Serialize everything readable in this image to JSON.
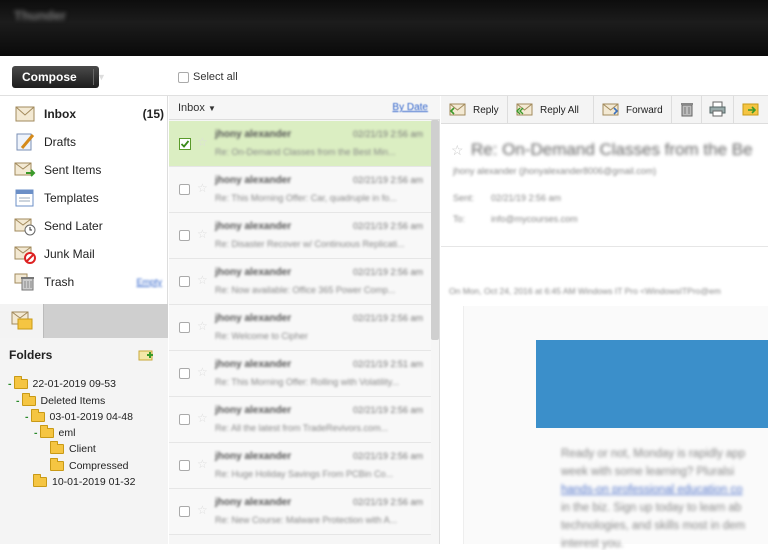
{
  "app": {
    "title_blurred": "Thunder"
  },
  "toolbar": {
    "compose_label": "Compose",
    "select_all_label": "Select all"
  },
  "nav": [
    {
      "label": "Inbox",
      "count": "(15)",
      "icon": "inbox-icon"
    },
    {
      "label": "Drafts",
      "icon": "drafts-icon"
    },
    {
      "label": "Sent Items",
      "icon": "sent-icon"
    },
    {
      "label": "Templates",
      "icon": "templates-icon"
    },
    {
      "label": "Send Later",
      "icon": "send-later-icon"
    },
    {
      "label": "Junk Mail",
      "icon": "junk-icon"
    },
    {
      "label": "Trash",
      "icon": "trash-icon",
      "action": "Empty"
    }
  ],
  "folders": {
    "title": "Folders",
    "tree": [
      {
        "label": "22-01-2019 09-53"
      },
      {
        "label": "Deleted Items"
      },
      {
        "label": "03-01-2019 04-48"
      },
      {
        "label": "eml"
      },
      {
        "label": "Client"
      },
      {
        "label": "Compressed"
      },
      {
        "label": "10-01-2019 01-32"
      }
    ]
  },
  "message_list": {
    "folder_label": "Inbox",
    "sort_label": "By Date",
    "rows": [
      {
        "from": "jhony alexander",
        "date": "02/21/19 2:56 am",
        "subject": "Re: On-Demand Classes from the Best Min...",
        "selected": true
      },
      {
        "from": "jhony alexander",
        "date": "02/21/19 2:56 am",
        "subject": "Re: This Morning Offer: Car, quadruple in fo...",
        "selected": false
      },
      {
        "from": "jhony alexander",
        "date": "02/21/19 2:56 am",
        "subject": "Re: Disaster Recover w/ Continuous Replicati...",
        "selected": false
      },
      {
        "from": "jhony alexander",
        "date": "02/21/19 2:56 am",
        "subject": "Re: Now available: Office 365 Power Comp...",
        "selected": false
      },
      {
        "from": "jhony alexander",
        "date": "02/21/19 2:56 am",
        "subject": "Re: Welcome to Cipher",
        "selected": false
      },
      {
        "from": "jhony alexander",
        "date": "02/21/19 2:51 am",
        "subject": "Re: This Morning Offer: Rolling with Volatility...",
        "selected": false
      },
      {
        "from": "jhony alexander",
        "date": "02/21/19 2:56 am",
        "subject": "Re: All the latest from TradeRevivors.com...",
        "selected": false
      },
      {
        "from": "jhony alexander",
        "date": "02/21/19 2:56 am",
        "subject": "Re: Huge Holiday Savings From PCBin Co...",
        "selected": false
      },
      {
        "from": "jhony alexander",
        "date": "02/21/19 2:56 am",
        "subject": "Re: New Course: Malware Protection with A...",
        "selected": false
      }
    ]
  },
  "reader": {
    "buttons": [
      {
        "label": "Reply",
        "icon": "reply-icon"
      },
      {
        "label": "Reply All",
        "icon": "reply-all-icon"
      },
      {
        "label": "Forward",
        "icon": "forward-icon"
      }
    ],
    "subject": "Re: On-Demand Classes from the Be",
    "sender": "jhony alexander (jhonyalexander8006@gmail.com)",
    "sent_label": "Sent:",
    "sent_value": "02/21/19 2:56 am",
    "to_label": "To:",
    "to_value": "info@mycourses.com",
    "quote_header": "On Mon, Oct 24, 2016 at 6:45 AM Windows IT Pro <WindowsITPro@em",
    "body_lines": [
      "Ready or not, Monday is rapidly app",
      "week with some learning? Pluralsi",
      "hands-on professional education co",
      "in the biz. Sign up today to learn ab",
      "technologies, and skills most in dem",
      "interest you."
    ]
  },
  "colors": {
    "selected_row": "#dbeec2",
    "compose_bg": "#2b2b2b",
    "banner_blue": "#3b8fca",
    "link": "#3366cc"
  }
}
